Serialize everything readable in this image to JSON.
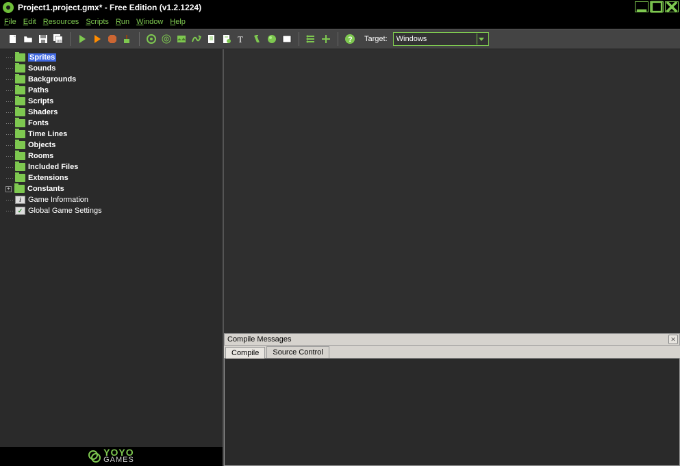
{
  "window": {
    "title": "Project1.project.gmx*  -  Free Edition (v1.2.1224)"
  },
  "menu": [
    "File",
    "Edit",
    "Resources",
    "Scripts",
    "Run",
    "Window",
    "Help"
  ],
  "toolbar": {
    "target_label": "Target:",
    "target_value": "Windows"
  },
  "tree": [
    {
      "label": "Sprites",
      "icon": "folder",
      "selected": true
    },
    {
      "label": "Sounds",
      "icon": "folder"
    },
    {
      "label": "Backgrounds",
      "icon": "folder"
    },
    {
      "label": "Paths",
      "icon": "folder"
    },
    {
      "label": "Scripts",
      "icon": "folder"
    },
    {
      "label": "Shaders",
      "icon": "folder"
    },
    {
      "label": "Fonts",
      "icon": "folder"
    },
    {
      "label": "Time Lines",
      "icon": "folder"
    },
    {
      "label": "Objects",
      "icon": "folder"
    },
    {
      "label": "Rooms",
      "icon": "folder"
    },
    {
      "label": "Included Files",
      "icon": "folder"
    },
    {
      "label": "Extensions",
      "icon": "folder"
    },
    {
      "label": "Constants",
      "icon": "folder",
      "expandable": true
    },
    {
      "label": "Game Information",
      "icon": "info",
      "nobold": true
    },
    {
      "label": "Global Game Settings",
      "icon": "check",
      "nobold": true
    }
  ],
  "footer": {
    "brand_top": "YOYO",
    "brand_bottom": "GAMES"
  },
  "compile": {
    "title": "Compile Messages",
    "tabs": [
      "Compile",
      "Source Control"
    ],
    "active_tab": 0
  }
}
